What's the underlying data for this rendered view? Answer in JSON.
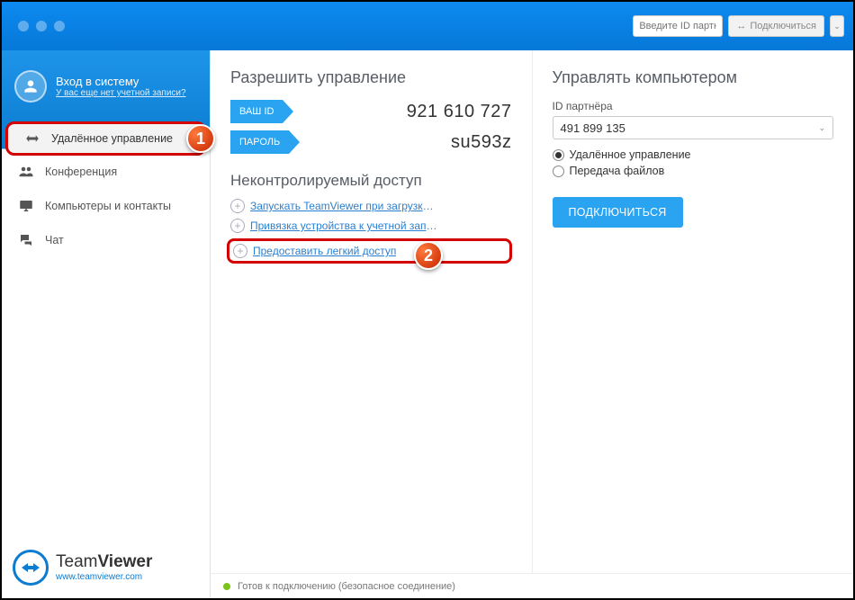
{
  "titlebar": {
    "partner_placeholder": "Введите ID партн",
    "connect_label": "Подключиться"
  },
  "sidebar": {
    "login_title": "Вход в систему",
    "login_sub": "У вас еще нет учетной записи?",
    "items": [
      {
        "label": "Удалённое управление"
      },
      {
        "label": "Конференция"
      },
      {
        "label": "Компьютеры и контакты"
      },
      {
        "label": "Чат"
      }
    ],
    "brand_name_light": "Team",
    "brand_name_bold": "Viewer",
    "brand_url": "www.teamviewer.com"
  },
  "left": {
    "heading": "Разрешить управление",
    "id_label": "ВАШ ID",
    "id_value": "921 610 727",
    "pass_label": "ПАРОЛЬ",
    "pass_value": "su593z",
    "ua_heading": "Неконтролируемый доступ",
    "links": [
      "Запускать TeamViewer при загрузке с...",
      "Привязка устройства к учетной записи",
      "Предоставить легкий доступ"
    ]
  },
  "right": {
    "heading": "Управлять компьютером",
    "partner_label": "ID партнёра",
    "partner_value": "491 899 135",
    "radio_remote": "Удалённое управление",
    "radio_files": "Передача файлов",
    "connect_btn": "ПОДКЛЮЧИТЬСЯ"
  },
  "status": "Готов к подключению (безопасное соединение)",
  "annotations": {
    "b1": "1",
    "b2": "2"
  }
}
